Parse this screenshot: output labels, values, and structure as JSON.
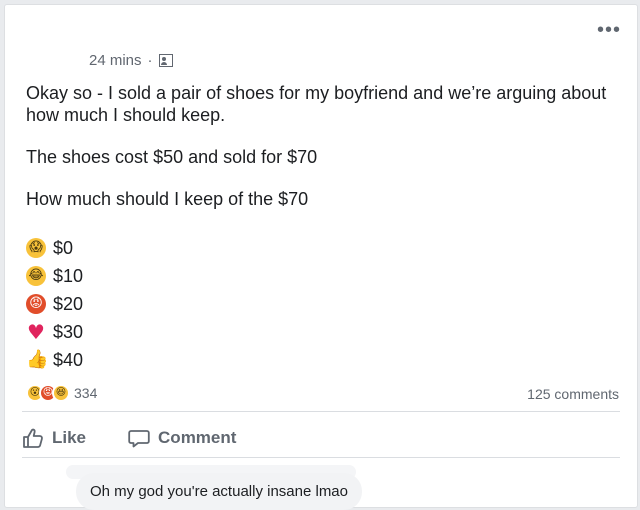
{
  "post": {
    "timestamp": "24 mins",
    "separator": "·",
    "privacy_icon": "friends-icon",
    "more_label": "•••",
    "paragraphs": [
      "Okay so - I sold a pair of shoes for my boyfriend and we’re arguing about how much I should keep.",
      "The shoes cost $50 and sold for $70",
      "How much should I keep of the $70"
    ],
    "options": [
      {
        "emoji": "scream",
        "glyph": "😱",
        "label": "$0"
      },
      {
        "emoji": "laugh",
        "glyph": "😂",
        "label": "$10"
      },
      {
        "emoji": "angry",
        "glyph": "😡",
        "label": "$20"
      },
      {
        "emoji": "heart",
        "glyph": "♥",
        "label": "$30"
      },
      {
        "emoji": "thumbs-up",
        "glyph": "👍",
        "label": "$40"
      }
    ]
  },
  "reactions": {
    "icons": [
      {
        "name": "wow",
        "glyph": "😮"
      },
      {
        "name": "angry",
        "glyph": "😡"
      },
      {
        "name": "haha",
        "glyph": "😆"
      }
    ],
    "count": "334",
    "comments": "125 comments"
  },
  "actions": {
    "like_label": "Like",
    "comment_label": "Comment"
  },
  "comment": {
    "text": "Oh my god you're actually insane lmao"
  },
  "colors": {
    "background": "#e9ebee",
    "card": "#ffffff",
    "secondary_text": "#606770",
    "angry": "#e14d2a",
    "haha": "#f8c23a",
    "heart": "#e0245e"
  }
}
